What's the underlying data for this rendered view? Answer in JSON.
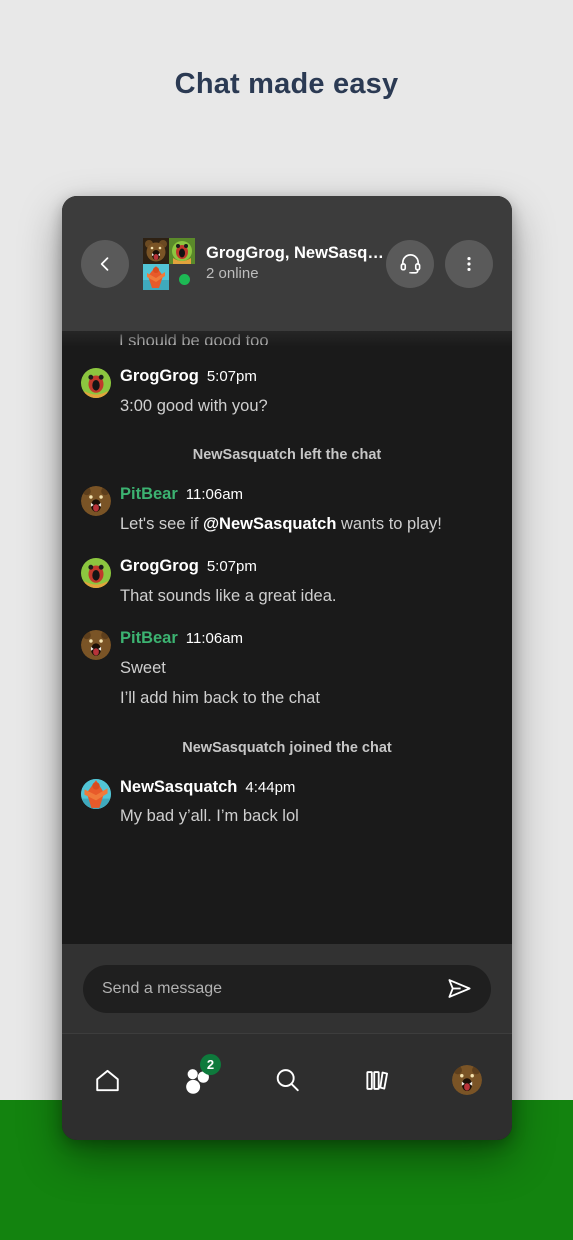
{
  "page": {
    "headline": "Chat made easy",
    "background_top_color": "#e8e8e8",
    "background_bottom_color": "#13830f",
    "headline_color": "#2b3a53"
  },
  "chat_header": {
    "back_icon": "chevron-left-icon",
    "title": "GrogGrog, NewSasq…",
    "subtitle": "2 online",
    "online_dot_color": "#1db954",
    "actions": [
      {
        "icon": "headset-icon",
        "name": "start-call-button"
      },
      {
        "icon": "more-vertical-icon",
        "name": "more-options-button"
      }
    ],
    "avatar_stack": [
      {
        "name": "pitbear-avatar",
        "kind": "bear"
      },
      {
        "name": "groggrog-avatar",
        "kind": "grog"
      },
      {
        "name": "newsasquatch-avatar",
        "kind": "sasquatch"
      },
      {
        "name": "empty-avatar-slot",
        "kind": "empty"
      }
    ]
  },
  "messages": {
    "cut_off_top": "I should be good too",
    "items": [
      {
        "type": "message",
        "author": "GrogGrog",
        "author_color": "#ffffff",
        "time": "5:07pm",
        "avatar": "grog",
        "lines": [
          {
            "text": "3:00 good with you?"
          }
        ]
      },
      {
        "type": "system",
        "text": "NewSasquatch left the chat"
      },
      {
        "type": "message",
        "author": "PitBear",
        "author_color": "#3cb371",
        "time": "11:06am",
        "avatar": "bear",
        "lines": [
          {
            "pre": "Let's see if ",
            "mention": "@NewSasquatch",
            "post": " wants to play!"
          }
        ]
      },
      {
        "type": "message",
        "author": "GrogGrog",
        "author_color": "#ffffff",
        "time": "5:07pm",
        "avatar": "grog",
        "lines": [
          {
            "text": "That sounds like a great idea."
          }
        ]
      },
      {
        "type": "message",
        "author": "PitBear",
        "author_color": "#3cb371",
        "time": "11:06am",
        "avatar": "bear",
        "lines": [
          {
            "text": "Sweet"
          },
          {
            "text": "I’ll add him back to the chat"
          }
        ]
      },
      {
        "type": "system",
        "text": "NewSasquatch joined the chat"
      },
      {
        "type": "message",
        "author": "NewSasquatch",
        "author_color": "#ffffff",
        "time": "4:44pm",
        "avatar": "sasquatch",
        "lines": [
          {
            "text": "My bad y’all. I’m back lol"
          }
        ]
      }
    ]
  },
  "composer": {
    "placeholder": "Send a message",
    "value": "",
    "send_icon": "send-icon"
  },
  "bottom_nav": {
    "items": [
      {
        "name": "nav-home",
        "icon": "home-icon",
        "badge": null
      },
      {
        "name": "nav-people",
        "icon": "people-icon",
        "badge": "2"
      },
      {
        "name": "nav-search",
        "icon": "search-icon",
        "badge": null
      },
      {
        "name": "nav-library",
        "icon": "library-icon",
        "badge": null
      },
      {
        "name": "nav-profile",
        "icon": "bear-avatar-icon",
        "badge": null
      }
    ],
    "badge_color": "#0e7a3c"
  }
}
